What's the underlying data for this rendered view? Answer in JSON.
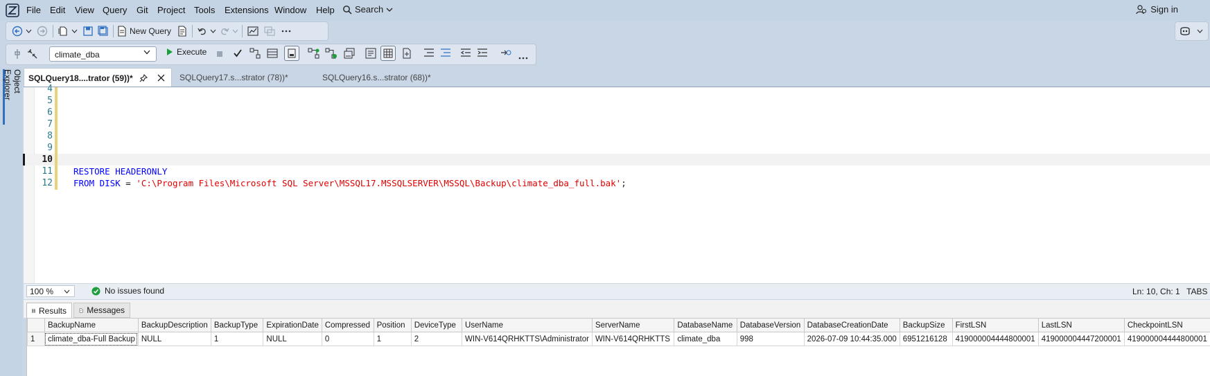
{
  "menu": {
    "items": [
      "File",
      "Edit",
      "View",
      "Query",
      "Git",
      "Project",
      "Tools",
      "Extensions",
      "Window",
      "Help"
    ],
    "search_label": "Search",
    "signin_label": "Sign in"
  },
  "toolbar1": {
    "new_query_label": "New Query"
  },
  "toolbar2": {
    "database": "climate_dba",
    "execute_label": "Execute"
  },
  "side": {
    "object_explorer_label": "Object Explorer"
  },
  "tabs": [
    {
      "label": "SQLQuery18....trator (59))*",
      "active": true
    },
    {
      "label": "SQLQuery17.s...strator (78))*",
      "active": false
    },
    {
      "label": "SQLQuery16.s...strator (68))*",
      "active": false
    }
  ],
  "editor": {
    "line_numbers": [
      "4",
      "5",
      "6",
      "7",
      "8",
      "9",
      "10",
      "11",
      "12"
    ],
    "line11_keyword": "RESTORE HEADERONLY",
    "line12_kw1": "FROM DISK",
    "line12_eq": " = ",
    "line12_string": "'C:\\Program Files\\Microsoft SQL Server\\MSSQL17.MSSQLSERVER\\MSSQL\\Backup\\climate_dba_full.bak'",
    "line12_end": ";"
  },
  "status": {
    "zoom": "100 %",
    "issues": "No issues found",
    "position": "Ln: 10, Ch: 1",
    "mode": "TABS"
  },
  "results": {
    "tab_results": "Results",
    "tab_messages": "Messages",
    "columns": [
      "BackupName",
      "BackupDescription",
      "BackupType",
      "ExpirationDate",
      "Compressed",
      "Position",
      "DeviceType",
      "UserName",
      "ServerName",
      "DatabaseName",
      "DatabaseVersion",
      "DatabaseCreationDate",
      "BackupSize",
      "FirstLSN",
      "LastLSN",
      "CheckpointLSN"
    ],
    "rows": [
      [
        "1",
        "climate_dba-Full Backup",
        "NULL",
        "1",
        "NULL",
        "0",
        "1",
        "2",
        "WIN-V614QRHKTTS\\Administrator",
        "WIN-V614QRHKTTS",
        "climate_dba",
        "998",
        "2026-07-09 10:44:35.000",
        "6951216128",
        "419000004444800001",
        "419000004447200001",
        "419000004444800001"
      ]
    ]
  },
  "colors": {
    "keyword": "#0000ff",
    "string": "#e00000",
    "line_number": "#2b7a8c",
    "ok_green": "#1e9e3a"
  }
}
